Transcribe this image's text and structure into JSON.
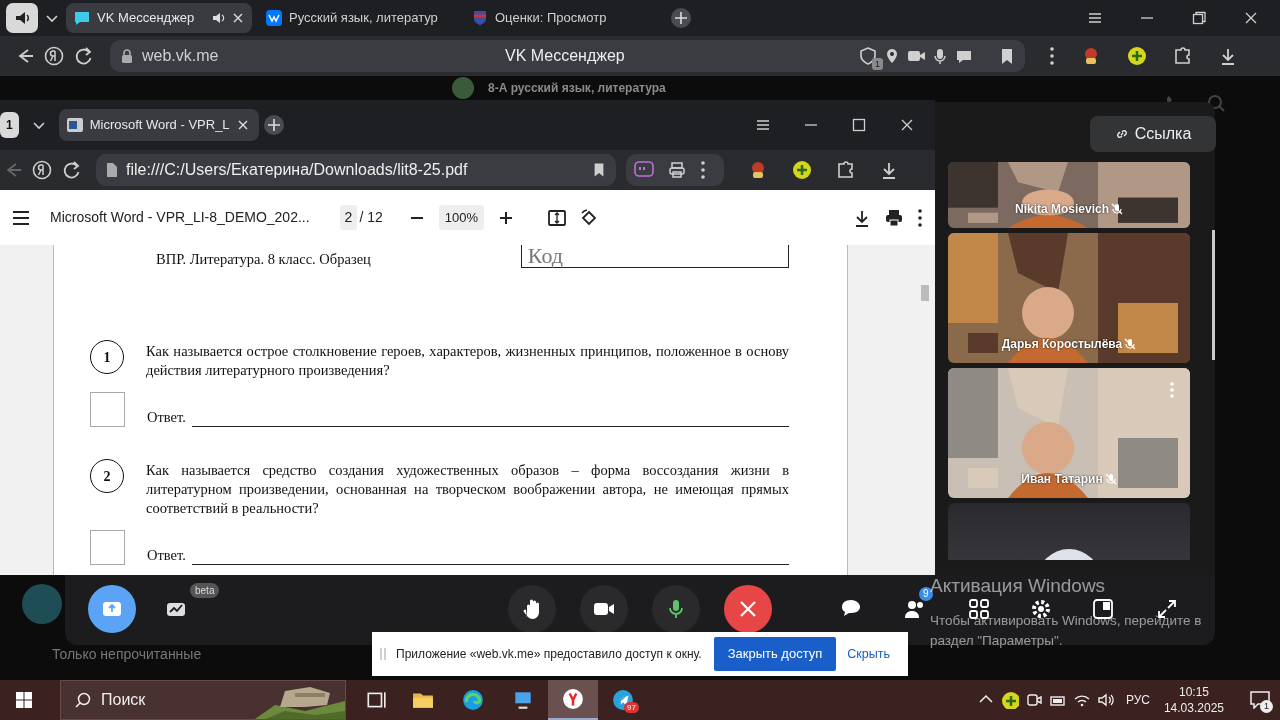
{
  "browser": {
    "tabs": [
      {
        "title": "VK Мессенджер",
        "selected": true,
        "audio": true
      },
      {
        "title": "Русский язык, литератур",
        "selected": false,
        "audio": false
      },
      {
        "title": "Оценки: Просмотр",
        "selected": false,
        "audio": false
      }
    ],
    "address": "web.vk.me",
    "page_title": "VK Мессенджер",
    "permission_badge": "1"
  },
  "background_chat": {
    "chat_title": "8-А русский язык, литература",
    "filter": "Только непрочитанные"
  },
  "pdf_window": {
    "window_count": "1",
    "tabs": [
      {
        "title": "Microsoft Word - VPR_L",
        "selected": true
      }
    ],
    "address": "file:///C:/Users/Екатерина/Downloads/lit8-25.pdf",
    "doc_title": "Microsoft Word - VPR_LI-8_DEMO_202...",
    "page": "2",
    "page_total": "/ 12",
    "zoom": "100%",
    "page_header": "ВПР. Литература. 8 класс. Образец",
    "code_label": "Код",
    "questions": [
      {
        "number": "1",
        "text": "Как называется острое столкновение героев, характеров, жизненных принципов, положенное в основу действия литературного произведения?",
        "answer_label": "Ответ."
      },
      {
        "number": "2",
        "text": "Как называется средство создания художественных образов – форма воссоздания жизни в литературном произведении, основанная на творческом воображении автора, не имеющая прямых соответствий в реальности?",
        "answer_label": "Ответ."
      }
    ]
  },
  "call": {
    "link_button": "Ссылка",
    "participants": [
      {
        "kind": "video",
        "name": "Nikita Mosievich",
        "muted": true
      },
      {
        "kind": "video",
        "name": "Дарья Коростылёва",
        "muted": true
      },
      {
        "kind": "video",
        "name": "Иван Татарин",
        "muted": true
      },
      {
        "kind": "avatar"
      }
    ],
    "beta_label": "beta",
    "people_count": "9"
  },
  "activation": {
    "title": "Активация Windows",
    "text": "Чтобы активировать Windows, перейдите в раздел \"Параметры\"."
  },
  "share_bar": {
    "message": "Приложение «web.vk.me» предоставило доступ к окну.",
    "stop_button": "Закрыть доступ",
    "hide_button": "Скрыть"
  },
  "taskbar": {
    "search_placeholder": "Поиск",
    "telegram_badge": "97",
    "language": "РУС",
    "time": "10:15",
    "date": "14.03.2025",
    "notification_count": "1"
  }
}
